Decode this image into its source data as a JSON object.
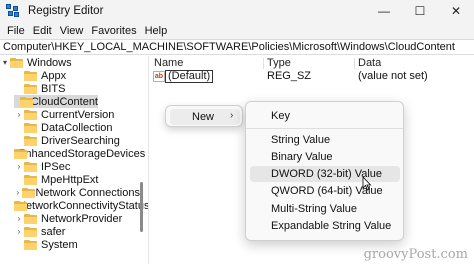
{
  "window": {
    "title": "Registry Editor",
    "controls": [
      "—",
      "☐",
      "✕"
    ]
  },
  "menu": [
    "File",
    "Edit",
    "View",
    "Favorites",
    "Help"
  ],
  "address": "Computer\\HKEY_LOCAL_MACHINE\\SOFTWARE\\Policies\\Microsoft\\Windows\\CloudContent",
  "tree": {
    "items": [
      {
        "label": "Windows",
        "chevron": "▾"
      },
      {
        "label": "Appx",
        "chevron": ""
      },
      {
        "label": "BITS",
        "chevron": ""
      },
      {
        "label": "CloudContent",
        "chevron": "",
        "selected": true
      },
      {
        "label": "CurrentVersion",
        "chevron": "›"
      },
      {
        "label": "DataCollection",
        "chevron": ""
      },
      {
        "label": "DriverSearching",
        "chevron": ""
      },
      {
        "label": "EnhancedStorageDevices",
        "chevron": ""
      },
      {
        "label": "IPSec",
        "chevron": "›"
      },
      {
        "label": "MpeHttpExt",
        "chevron": ""
      },
      {
        "label": "Network Connections",
        "chevron": "›"
      },
      {
        "label": "NetworkConnectivityStatusIndicator",
        "chevron": ""
      },
      {
        "label": "NetworkProvider",
        "chevron": "›"
      },
      {
        "label": "safer",
        "chevron": "›"
      },
      {
        "label": "System",
        "chevron": ""
      }
    ]
  },
  "columns": {
    "name": "Name",
    "type": "Type",
    "data": "Data"
  },
  "values": [
    {
      "icon": "ab",
      "name": "(Default)",
      "type": "REG_SZ",
      "data": "(value not set)"
    }
  ],
  "context_menu": {
    "new_label": "New",
    "arrow": "›"
  },
  "submenu": {
    "items": [
      "Key",
      "String Value",
      "Binary Value",
      "DWORD (32-bit) Value",
      "QWORD (64-bit) Value",
      "Multi-String Value",
      "Expandable String Value"
    ],
    "hovered": "DWORD (32-bit) Value"
  },
  "watermark": "groovyPost.com",
  "colors": {
    "folder": "#ffd36b",
    "folder_dark": "#e9b64a",
    "selection": "#d9d9d9",
    "menu_bg": "#f9f9f9"
  }
}
